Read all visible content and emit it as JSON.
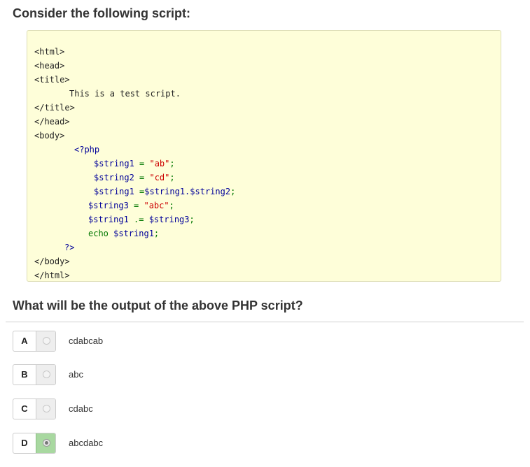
{
  "question": {
    "intro": "Consider the following script:",
    "prompt": "What will be the output of the above PHP script?"
  },
  "code": {
    "l1": "<html>",
    "l2": "<head>",
    "l3": "<title>",
    "l4": "This is a test script.",
    "l5": "</title>",
    "l6": "</head>",
    "l7": "<body>",
    "l8": "<?php",
    "l9": {
      "var": "$string1",
      "op": " = ",
      "str": "\"ab\"",
      "end": ";"
    },
    "l10": {
      "var": "$string2",
      "op": " = ",
      "str": "\"cd\"",
      "end": ";"
    },
    "l11": {
      "var": "$string1",
      "op": " =",
      "expr": "$string1.$string2",
      "end": ";"
    },
    "l12": {
      "var": "$string3",
      "op": " = ",
      "str": "\"abc\"",
      "end": ";"
    },
    "l13": {
      "var": "$string1",
      "op": " .= ",
      "expr": "$string3",
      "end": ";"
    },
    "l14": {
      "kw": "echo ",
      "expr": "$string1",
      "end": ";"
    },
    "l15": "?>",
    "l16": "</body>",
    "l17": "</html>"
  },
  "options": [
    {
      "letter": "A",
      "text": "cdabcab",
      "selected": false
    },
    {
      "letter": "B",
      "text": "abc",
      "selected": false
    },
    {
      "letter": "C",
      "text": "cdabc",
      "selected": false
    },
    {
      "letter": "D",
      "text": "abcdabc",
      "selected": true
    }
  ],
  "colors": {
    "code_background": "#fefed9",
    "selected_radio_cell": "#a8d8a0",
    "php_variable": "#000099",
    "php_string": "#cc0000",
    "php_keyword": "#007700"
  }
}
